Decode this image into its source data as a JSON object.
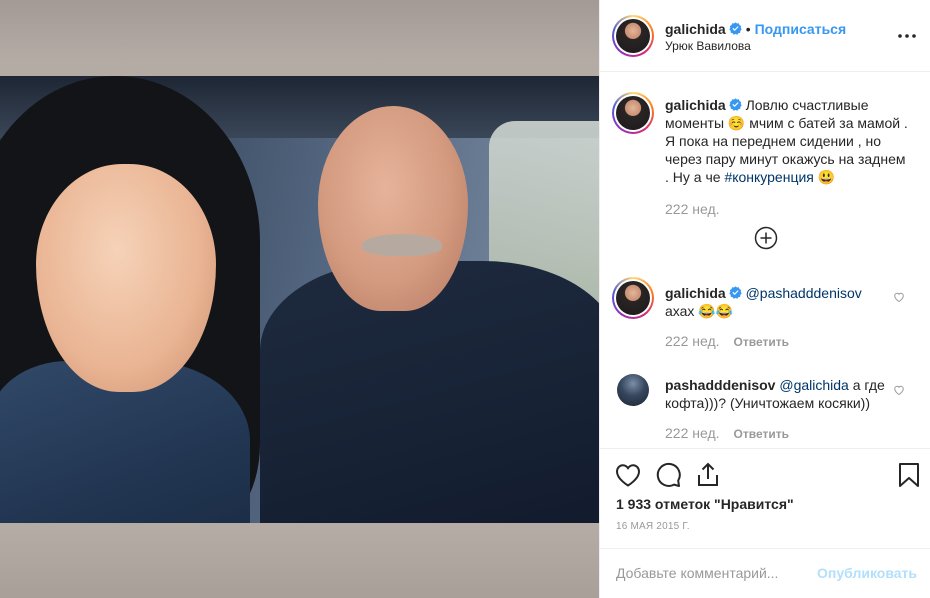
{
  "post": {
    "author": "galichida",
    "follow_label": "Подписаться",
    "location": "Урюк Вавилова",
    "more_icon": "more-horizontal-icon"
  },
  "caption": {
    "username": "galichida",
    "text": "Ловлю счастливые моменты ☺️ мчим с батей за мамой . Я пока на переднем сидении , но через пару минут окажусь на заднем . Ну а че ",
    "hashtag": "#конкуренция",
    "emoji": "😃",
    "time": "222 нед."
  },
  "load_more_icon": "plus-circle-icon",
  "comments": [
    {
      "username": "galichida",
      "mention": "@pashadddenisov",
      "text": "ахах 😂😂",
      "time": "222 нед.",
      "reply": "Ответить"
    },
    {
      "username": "pashadddenisov",
      "mention": "@galichida",
      "text": " а где кофта)))? (Уничтожаем косяки))",
      "time": "222 нед.",
      "reply": "Ответить"
    }
  ],
  "likes_text": "1 933 отметок \"Нравится\"",
  "date_text": "16 мая 2015 г.",
  "comment_box": {
    "placeholder": "Добавьте комментарий...",
    "publish_label": "Опубликовать"
  },
  "colors": {
    "link": "#3897f0",
    "verified": "#3897f0",
    "muted": "#999999",
    "publish_disabled": "#b2dffc"
  }
}
